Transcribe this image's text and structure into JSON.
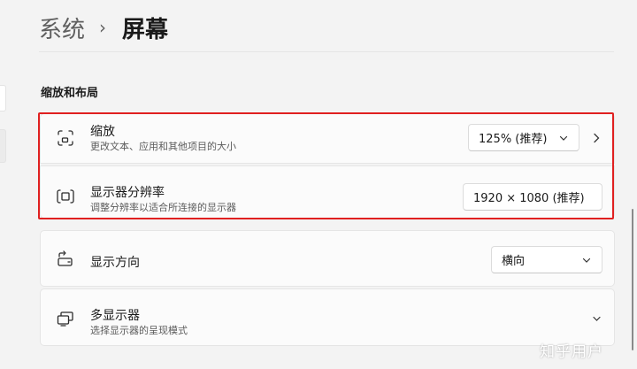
{
  "breadcrumb": {
    "parent": "系统",
    "separator": "›",
    "current": "屏幕"
  },
  "section": {
    "title": "缩放和布局"
  },
  "rows": {
    "scale": {
      "icon": "scale-icon",
      "title": "缩放",
      "subtitle": "更改文本、应用和其他项目的大小",
      "dropdown_value": "125% (推荐)"
    },
    "resolution": {
      "icon": "resolution-icon",
      "title": "显示器分辨率",
      "subtitle": "调整分辨率以适合所连接的显示器",
      "dropdown_value": "1920 × 1080 (推荐)"
    },
    "orientation": {
      "icon": "orientation-icon",
      "title": "显示方向",
      "dropdown_value": "横向"
    },
    "multi_display": {
      "icon": "multi-display-icon",
      "title": "多显示器",
      "subtitle": "选择显示器的呈现模式"
    }
  },
  "highlight_color": "#e02020",
  "watermark": "知乎用户"
}
